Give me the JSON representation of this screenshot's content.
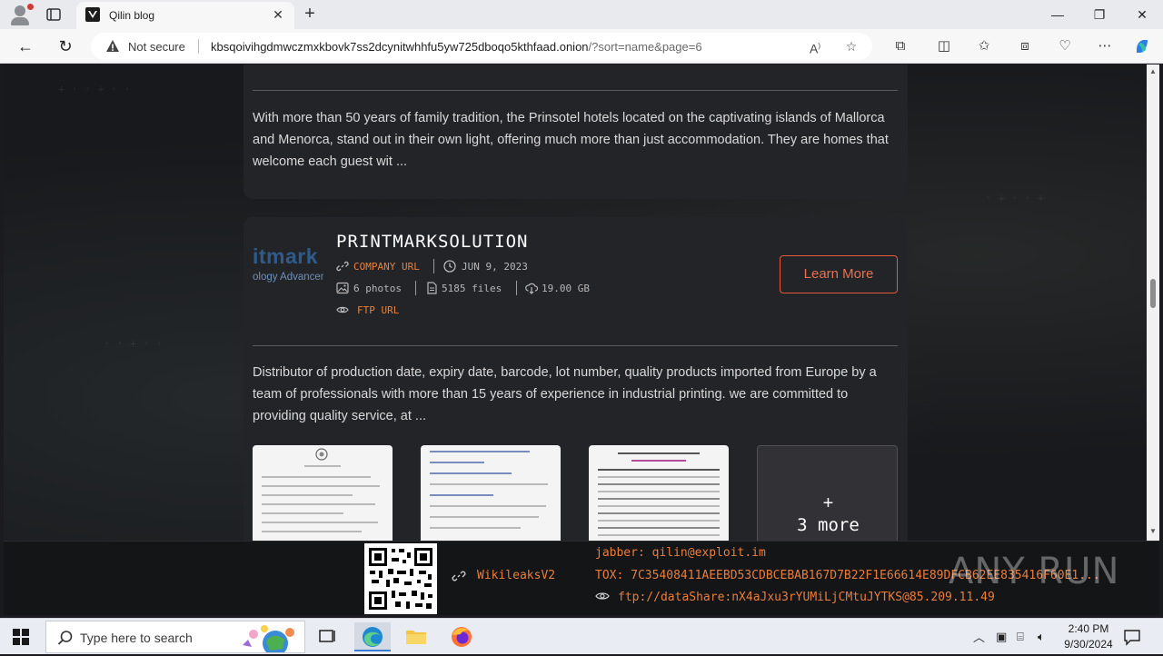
{
  "browser": {
    "tab_title": "Qilin blog",
    "security_label": "Not secure",
    "url_host": "kbsqoivihgdmwczmxkbovk7ss2dcynitwhhfu5yw725dboqo5kthfaad.onion",
    "url_path": "/?sort=name&page=6"
  },
  "card_prev": {
    "description": "With more than 50 years of family tradition, the Prinsotel hotels located on the captivating islands of Mallorca and Menorca, stand out in their own light, offering much more than just accommodation. They are homes that welcome each guest wit ..."
  },
  "card_main": {
    "logo_top": "itmark",
    "logo_bottom": "ology Advancen",
    "title": "PRINTMARKSOLUTION",
    "company_url_label": "COMPANY URL",
    "date": "JUN 9, 2023",
    "photos": "6 photos",
    "files": "5185 files",
    "size": "19.00 GB",
    "ftp_label": "FTP URL",
    "learn_more": "Learn More",
    "description": "Distributor of production date, expiry date, barcode, lot number, quality products imported from Europe by a team of professionals with more than 15 years of experience in industrial printing. we are committed to providing quality service, at ...",
    "more_plus": "+",
    "more_label": "3 more"
  },
  "footer": {
    "wikileaks": "WikileaksV2",
    "jabber": "jabber: qilin@exploit.im",
    "tox": "TOX: 7C35408411AEEBD53CDBCEBAB167D7B22F1E66614E89DFCB62EE835416F60E1...",
    "ftp": "ftp://dataShare:nX4aJxu3rYUMiLjCMtuJYTKS@85.209.11.49",
    "watermark": "ANY RUN"
  },
  "taskbar": {
    "search_placeholder": "Type here to search",
    "time": "2:40 PM",
    "date": "9/30/2024"
  },
  "colors": {
    "accent_orange": "#e8803a",
    "button_border": "#e55a3a",
    "card_bg": "#232428",
    "page_bg": "#18191c"
  }
}
